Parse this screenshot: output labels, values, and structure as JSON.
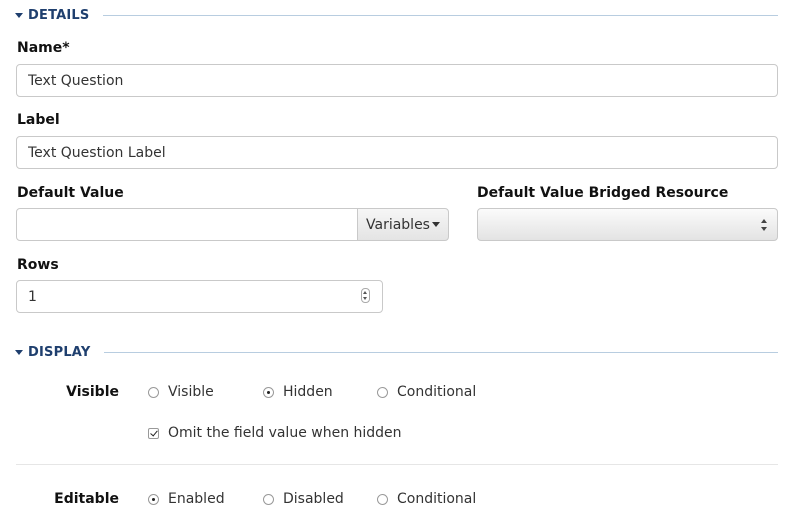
{
  "details": {
    "section_title": "DETAILS",
    "name": {
      "label": "Name*",
      "value": "Text Question"
    },
    "label_field": {
      "label": "Label",
      "value": "Text Question Label"
    },
    "default_value": {
      "label": "Default Value",
      "value": "",
      "button_label": "Variables"
    },
    "bridged_resource": {
      "label": "Default Value Bridged Resource",
      "value": ""
    },
    "rows": {
      "label": "Rows",
      "value": "1"
    }
  },
  "display": {
    "section_title": "DISPLAY",
    "visible": {
      "label": "Visible",
      "options": [
        "Visible",
        "Hidden",
        "Conditional"
      ],
      "selected": "Hidden",
      "omit_checkbox_label": "Omit the field value when hidden",
      "omit_checked": true
    },
    "editable": {
      "label": "Editable",
      "options": [
        "Enabled",
        "Disabled",
        "Conditional"
      ],
      "selected": "Enabled"
    }
  },
  "colors": {
    "section_title": "#1f3f6e",
    "section_rule": "#b8cde0",
    "input_border": "#c9c9c9"
  }
}
